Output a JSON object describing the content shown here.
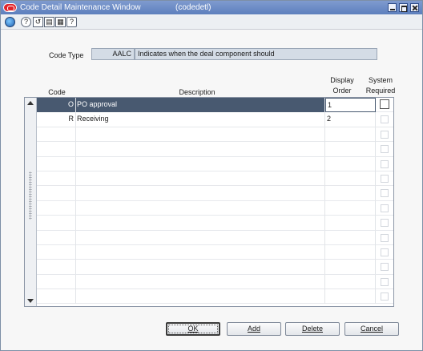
{
  "window": {
    "title": "Code Detail Maintenance Window",
    "subtitle": "(codedetl)"
  },
  "toolbar": {
    "icons": [
      "globe-icon",
      "help-icon",
      "record-icon",
      "note-icon",
      "print-icon",
      "question-icon"
    ],
    "glyphs": [
      "?",
      "↺",
      "▤",
      "▦",
      "?"
    ]
  },
  "code_type": {
    "label": "Code Type",
    "code": "AALC",
    "description": "Indicates when the deal component should"
  },
  "columns": {
    "code": "Code",
    "description": "Description",
    "display_line1": "Display",
    "display_line2": "Order",
    "system_line1": "System",
    "system_line2": "Required"
  },
  "rows": [
    {
      "code": "O",
      "description": "PO approval",
      "display_order": "1",
      "system_required": false,
      "selected": true
    },
    {
      "code": "R",
      "description": "Receiving",
      "display_order": "2",
      "system_required": false,
      "selected": false
    },
    {
      "code": "",
      "description": "",
      "display_order": "",
      "system_required": false,
      "selected": false
    },
    {
      "code": "",
      "description": "",
      "display_order": "",
      "system_required": false,
      "selected": false
    },
    {
      "code": "",
      "description": "",
      "display_order": "",
      "system_required": false,
      "selected": false
    },
    {
      "code": "",
      "description": "",
      "display_order": "",
      "system_required": false,
      "selected": false
    },
    {
      "code": "",
      "description": "",
      "display_order": "",
      "system_required": false,
      "selected": false
    },
    {
      "code": "",
      "description": "",
      "display_order": "",
      "system_required": false,
      "selected": false
    },
    {
      "code": "",
      "description": "",
      "display_order": "",
      "system_required": false,
      "selected": false
    },
    {
      "code": "",
      "description": "",
      "display_order": "",
      "system_required": false,
      "selected": false
    },
    {
      "code": "",
      "description": "",
      "display_order": "",
      "system_required": false,
      "selected": false
    },
    {
      "code": "",
      "description": "",
      "display_order": "",
      "system_required": false,
      "selected": false
    },
    {
      "code": "",
      "description": "",
      "display_order": "",
      "system_required": false,
      "selected": false
    },
    {
      "code": "",
      "description": "",
      "display_order": "",
      "system_required": false,
      "selected": false
    }
  ],
  "buttons": {
    "ok": "OK",
    "add": "Add",
    "delete": "Delete",
    "cancel": "Cancel"
  },
  "colors": {
    "titlebar": "#5d7fbd",
    "selected_row": "#485970"
  }
}
